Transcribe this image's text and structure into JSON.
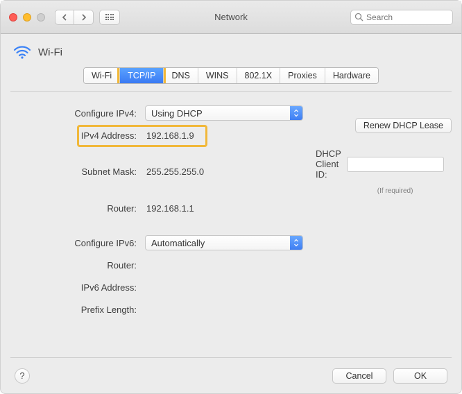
{
  "window": {
    "title": "Network"
  },
  "search": {
    "placeholder": "Search"
  },
  "header": {
    "connection_name": "Wi-Fi"
  },
  "tabs": [
    {
      "label": "Wi-Fi",
      "active": false
    },
    {
      "label": "TCP/IP",
      "active": true,
      "highlight": true
    },
    {
      "label": "DNS",
      "active": false
    },
    {
      "label": "WINS",
      "active": false
    },
    {
      "label": "802.1X",
      "active": false
    },
    {
      "label": "Proxies",
      "active": false
    },
    {
      "label": "Hardware",
      "active": false
    }
  ],
  "ipv4": {
    "configure_label": "Configure IPv4:",
    "configure_value": "Using DHCP",
    "address_label": "IPv4 Address:",
    "address_value": "192.168.1.9",
    "subnet_label": "Subnet Mask:",
    "subnet_value": "255.255.255.0",
    "router_label": "Router:",
    "router_value": "192.168.1.1"
  },
  "dhcp": {
    "renew_label": "Renew DHCP Lease",
    "client_id_label": "DHCP Client ID:",
    "client_id_note": "(If required)"
  },
  "ipv6": {
    "configure_label": "Configure IPv6:",
    "configure_value": "Automatically",
    "router_label": "Router:",
    "address_label": "IPv6 Address:",
    "prefix_label": "Prefix Length:"
  },
  "footer": {
    "help": "?",
    "cancel": "Cancel",
    "ok": "OK"
  }
}
